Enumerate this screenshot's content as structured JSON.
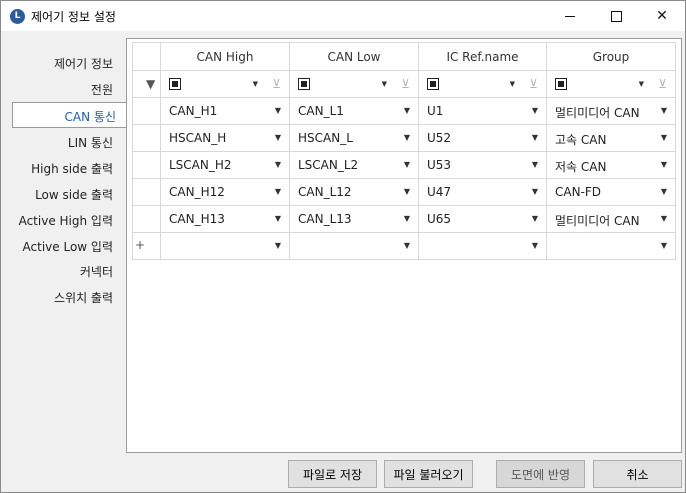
{
  "window": {
    "title": "제어기 정보 설정",
    "app_icon_letter": "L"
  },
  "sidebar": {
    "items": [
      {
        "label": "제어기 정보"
      },
      {
        "label": "전원"
      },
      {
        "label": "CAN 통신",
        "selected": true
      },
      {
        "label": "LIN 통신"
      },
      {
        "label": "High side 출력"
      },
      {
        "label": "Low side 출력"
      },
      {
        "label": "Active High 입력"
      },
      {
        "label": "Active Low 입력"
      },
      {
        "label": "커넥터"
      },
      {
        "label": "스위치 출력"
      }
    ]
  },
  "grid": {
    "columns": [
      "CAN High",
      "CAN Low",
      "IC Ref.name",
      "Group"
    ],
    "rows": [
      [
        "CAN_H1",
        "CAN_L1",
        "U1",
        "멀티미디어 CAN"
      ],
      [
        "HSCAN_H",
        "HSCAN_L",
        "U52",
        "고속 CAN"
      ],
      [
        "LSCAN_H2",
        "LSCAN_L2",
        "U53",
        "저속 CAN"
      ],
      [
        "CAN_H12",
        "CAN_L12",
        "U47",
        "CAN-FD"
      ],
      [
        "CAN_H13",
        "CAN_L13",
        "U65",
        "멀티미디어 CAN"
      ]
    ],
    "new_row_marker": "+"
  },
  "buttons": {
    "save_file": "파일로 저장",
    "load_file": "파일 불러오기",
    "apply_drawing": "도면에 반영",
    "cancel": "취소"
  },
  "icons": {
    "filter": "filter-icon",
    "clear_filter": "clear-filter-icon",
    "dropdown": "chevron-down-icon"
  }
}
